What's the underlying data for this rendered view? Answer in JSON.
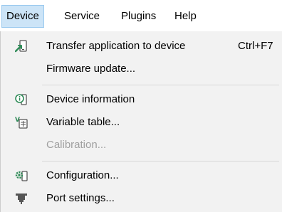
{
  "menubar": {
    "items": [
      {
        "label": "Device"
      },
      {
        "label": "Service"
      },
      {
        "label": "Plugins"
      },
      {
        "label": "Help"
      }
    ]
  },
  "device_menu": {
    "items": [
      {
        "label": "Transfer application to device",
        "shortcut": "Ctrl+F7",
        "icon": "transfer-device-icon",
        "enabled": true
      },
      {
        "label": "Firmware update...",
        "enabled": true
      },
      {
        "label": "Device information",
        "icon": "device-info-icon",
        "enabled": true
      },
      {
        "label": "Variable table...",
        "icon": "variable-table-icon",
        "enabled": true
      },
      {
        "label": "Calibration...",
        "enabled": false
      },
      {
        "label": "Configuration...",
        "icon": "configuration-icon",
        "enabled": true
      },
      {
        "label": "Port settings...",
        "icon": "port-settings-icon",
        "enabled": true
      }
    ]
  },
  "colors": {
    "active_menu_bg": "#cce4f7",
    "active_menu_border": "#99c9ef",
    "dropdown_bg": "#f2f2f2",
    "disabled_text": "#a0a0a0",
    "icon_green": "#2e8b57"
  }
}
